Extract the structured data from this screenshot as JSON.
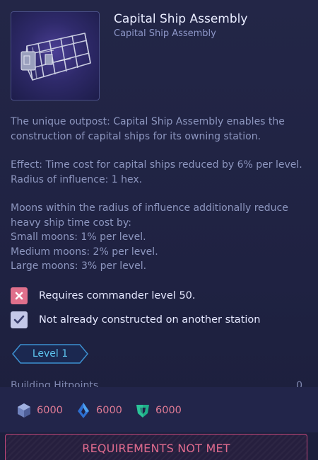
{
  "header": {
    "title": "Capital Ship Assembly",
    "subtitle": "Capital Ship Assembly",
    "image_icon": "capital-ship-assembly-structure"
  },
  "description": {
    "p1": "The unique outpost: Capital Ship Assembly enables the construction of capital ships for its owning station.",
    "p2_line1": "Effect: Time cost for capital ships reduced by 6% per level.",
    "p2_line2": "Radius of influence: 1 hex.",
    "p3_line1": "Moons within the radius of influence additionally reduce heavy ship time cost by:",
    "p3_line2": "Small moons: 1% per level.",
    "p3_line3": "Medium moons: 2% per level.",
    "p3_line4": "Large moons: 3% per level."
  },
  "requirements": [
    {
      "label": "Requires commander level 50.",
      "met": false,
      "icon": "x-icon",
      "color": "#e0708c"
    },
    {
      "label": "Not already constructed on another station",
      "met": true,
      "icon": "check-icon",
      "color": "#c4c8e8"
    }
  ],
  "level": {
    "label": "Level 1",
    "color": "#5ec4ee"
  },
  "stats": {
    "hitpoints_label": "Building Hitpoints",
    "hitpoints_value": "0"
  },
  "costs": [
    {
      "icon": "metal-cube-icon",
      "value": "6000",
      "color": "#7d8fc6"
    },
    {
      "icon": "crystal-icon",
      "value": "6000",
      "color": "#3f8be6"
    },
    {
      "icon": "gas-shield-icon",
      "value": "6000",
      "color": "#22c49a"
    }
  ],
  "action": {
    "label": "REQUIREMENTS NOT MET",
    "color": "#e06b8e"
  }
}
